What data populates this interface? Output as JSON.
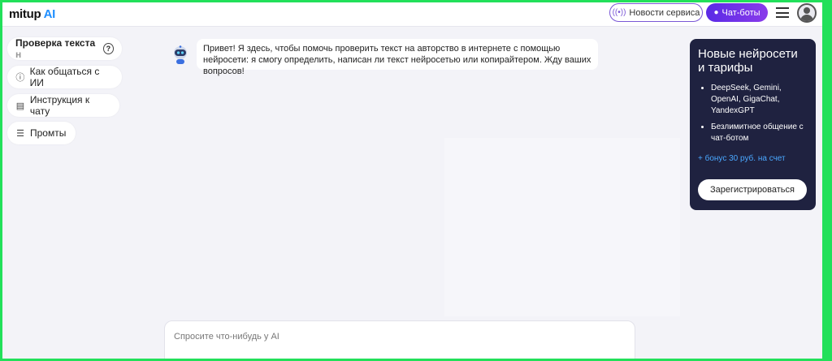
{
  "header": {
    "logo_main": "mitup",
    "logo_ai": "AI",
    "news_label": "Новости сервиса",
    "bots_label": "Чат-боты"
  },
  "sidebar": {
    "items": [
      {
        "label": "Проверка текста",
        "fade": " н",
        "icon": "help-circle-icon"
      },
      {
        "label": "Как общаться с ИИ",
        "icon": "question-circle-icon"
      },
      {
        "label": "Инструкция к чату",
        "icon": "document-icon"
      },
      {
        "label": "Промты",
        "icon": "database-icon"
      }
    ]
  },
  "chat": {
    "greeting": "Привет! Я здесь, чтобы помочь проверить текст на авторство в интернете с помощью нейросети: я смогу определить, написан ли текст нейросетью или копирайтером. Жду ваших вопросов!"
  },
  "promo": {
    "title": "Новые нейросети и тарифы",
    "features": [
      "DeepSeek, Gemini, OpenAI, GigaChat, YandexGPT",
      "Безлимитное общение с чат-ботом"
    ],
    "bonus": "+ бонус 30 руб. на счет",
    "register_label": "Зарегистрироваться"
  },
  "input": {
    "placeholder": "Спросите что-нибудь у AI",
    "value": ""
  },
  "colors": {
    "frame": "#22e05a",
    "accent_purple": "#6a34e8",
    "promo_bg": "#1f2240",
    "bonus_link": "#4aa8ff",
    "logo_ai": "#1f8fff"
  }
}
